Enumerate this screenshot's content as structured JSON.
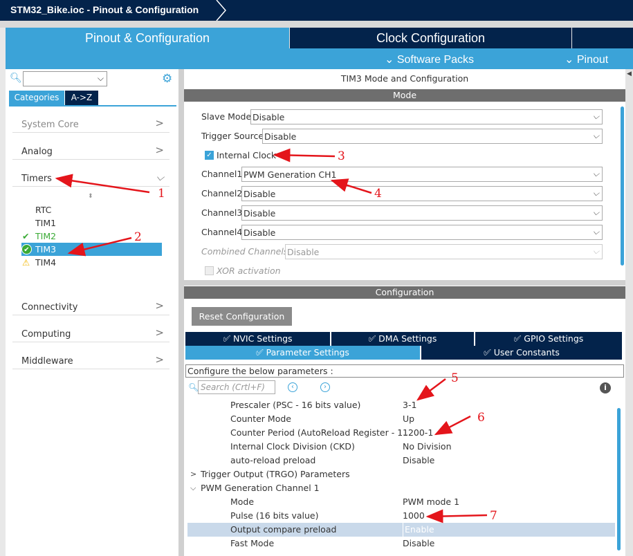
{
  "window": {
    "title": "STM32_Bike.ioc - Pinout & Configuration"
  },
  "tabs": {
    "pinout": "Pinout & Configuration",
    "clock": "Clock Configuration"
  },
  "menus": {
    "software_packs": "⌄ Software Packs",
    "pinout": "⌄ Pinout"
  },
  "sidebar": {
    "tab_categories": "Categories",
    "tab_az": "A->Z",
    "categories": [
      "System Core",
      "Analog",
      "Timers",
      "Connectivity",
      "Computing",
      "Middleware"
    ],
    "timers": [
      "RTC",
      "TIM1",
      "TIM2",
      "TIM3",
      "TIM4"
    ]
  },
  "colors": {
    "accent": "#3ba3d8",
    "navy": "#03234b",
    "green": "#3aaa35",
    "warning": "#f2b600",
    "annotation": "#e4151b"
  },
  "mode": {
    "title": "TIM3 Mode and Configuration",
    "header": "Mode",
    "slave_mode_label": "Slave Mode",
    "slave_mode_value": "Disable",
    "trigger_source_label": "Trigger Source",
    "trigger_source_value": "Disable",
    "internal_clock_label": "Internal Clock",
    "internal_clock_checked": true,
    "channel1_label": "Channel1",
    "channel1_value": "PWM Generation CH1",
    "channel2_label": "Channel2",
    "channel2_value": "Disable",
    "channel3_label": "Channel3",
    "channel3_value": "Disable",
    "channel4_label": "Channel4",
    "channel4_value": "Disable",
    "combined_label": "Combined Channels",
    "combined_value": "Disable",
    "xor_label": "XOR activation"
  },
  "config": {
    "header": "Configuration",
    "reset": "Reset Configuration",
    "tabs": [
      "NVIC Settings",
      "DMA Settings",
      "GPIO Settings",
      "Parameter Settings",
      "User Constants"
    ],
    "configure_label": "Configure the below parameters :",
    "search_placeholder": "Search (Crtl+F)",
    "params": [
      {
        "key": "Prescaler (PSC - 16 bits value)",
        "value": "3-1"
      },
      {
        "key": "Counter Mode",
        "value": "Up"
      },
      {
        "key": "Counter Period (AutoReload Register - 1...",
        "value": "1200-1"
      },
      {
        "key": "Internal Clock Division (CKD)",
        "value": "No Division"
      },
      {
        "key": "auto-reload preload",
        "value": "Disable"
      }
    ],
    "groups": [
      "Trigger Output (TRGO) Parameters",
      "PWM Generation Channel 1"
    ],
    "pwm_params": [
      {
        "key": "Mode",
        "value": "PWM mode 1"
      },
      {
        "key": "Pulse (16 bits value)",
        "value": "1000"
      },
      {
        "key": "Output compare preload",
        "value": "Enable"
      },
      {
        "key": "Fast Mode",
        "value": "Disable"
      }
    ]
  },
  "annotations": [
    "1",
    "2",
    "3",
    "4",
    "5",
    "6",
    "7"
  ]
}
